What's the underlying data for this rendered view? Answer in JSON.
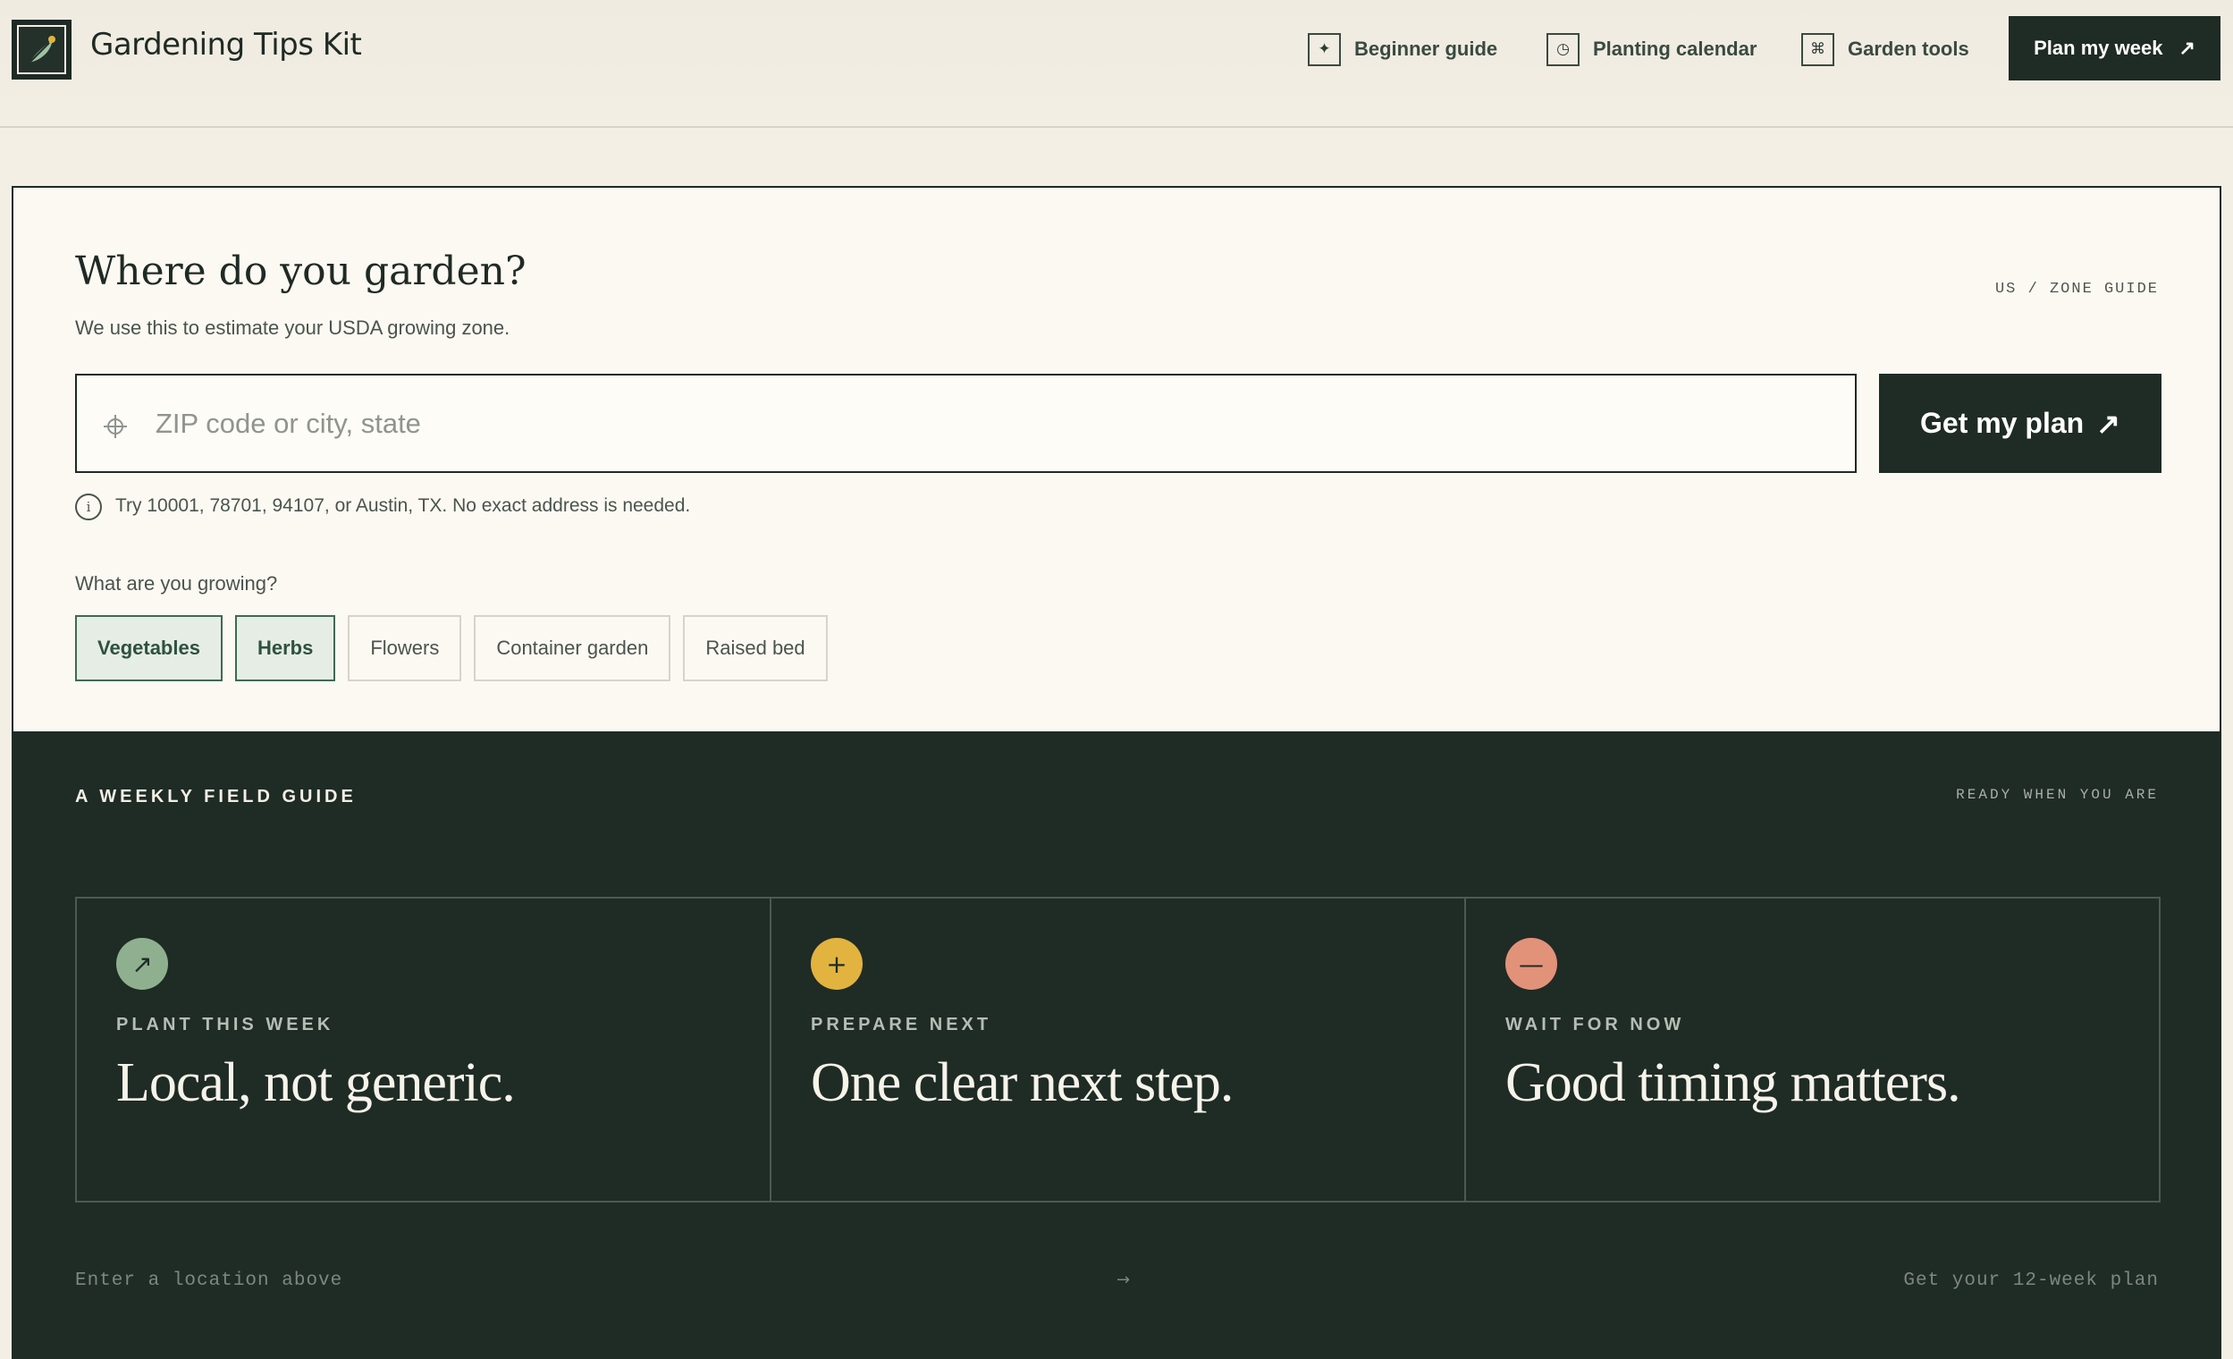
{
  "header": {
    "brand": "Gardening Tips Kit",
    "nav": [
      {
        "label": "Beginner guide",
        "icon": "sparkle-icon",
        "glyph": "✦"
      },
      {
        "label": "Planting calendar",
        "icon": "clock-icon",
        "glyph": "◷"
      },
      {
        "label": "Garden tools",
        "icon": "command-icon",
        "glyph": "⌘"
      }
    ],
    "cta_label": "Plan my week",
    "cta_arrow": "↗"
  },
  "location": {
    "title": "Where do you garden?",
    "subtitle": "We use this to estimate your USDA growing zone.",
    "region_tag": "US / ZONE GUIDE",
    "input_placeholder": "ZIP code or city, state",
    "input_value": "",
    "submit_label": "Get my plan",
    "submit_arrow": "↗",
    "hint_icon": "i",
    "hint": "Try 10001, 78701, 94107, or Austin, TX. No exact address is needed."
  },
  "growing": {
    "label": "What are you growing?",
    "options": [
      {
        "label": "Vegetables",
        "selected": true
      },
      {
        "label": "Herbs",
        "selected": true
      },
      {
        "label": "Flowers",
        "selected": false
      },
      {
        "label": "Container garden",
        "selected": false
      },
      {
        "label": "Raised bed",
        "selected": false
      }
    ]
  },
  "guide": {
    "eyebrow": "A WEEKLY FIELD GUIDE",
    "status": "READY WHEN YOU ARE",
    "cards": [
      {
        "kicker": "PLANT THIS WEEK",
        "headline": "Local, not generic.",
        "icon": "arrow-up-right-icon",
        "glyph": "↗",
        "color": "#8fb08f"
      },
      {
        "kicker": "PREPARE NEXT",
        "headline": "One clear next step.",
        "icon": "plus-icon",
        "glyph": "+",
        "color": "#e2b33e"
      },
      {
        "kicker": "WAIT FOR NOW",
        "headline": "Good timing matters.",
        "icon": "minus-icon",
        "glyph": "—",
        "color": "#e3927a"
      }
    ],
    "footer_left": "Enter a location above",
    "footer_arrow": "→",
    "footer_right": "Get your 12-week plan"
  },
  "colors": {
    "background": "#f3efe4",
    "ink": "#1f2a24",
    "dark_panel": "#1f2b25",
    "chip_selected_bg": "#e6ede5",
    "chip_selected_border": "#3f6a52"
  }
}
